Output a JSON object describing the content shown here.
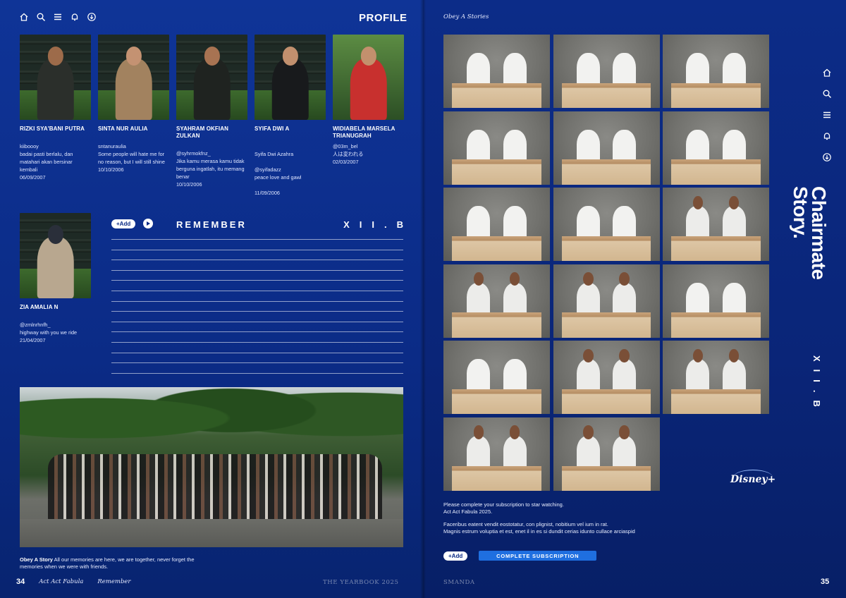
{
  "left": {
    "header": {
      "title": "PROFILE"
    },
    "icons": [
      "home-icon",
      "search-icon",
      "menu-icon",
      "bell-icon",
      "download-icon"
    ],
    "profiles": [
      {
        "name": "RIZKI SYA'BANI PUTRA",
        "handle": "kiiboooy",
        "quote": "badai pasti berlalu, dan matahari akan bersinar kembali",
        "date": "06/09/2007"
      },
      {
        "name": "SINTA NUR AULIA",
        "handle": "sntanuraulia",
        "quote": "Some people will hate me for no reason, but I will still shine",
        "date": "10/10/2006"
      },
      {
        "name": "SYAHRAM OKFIAN ZULKAN",
        "handle": "@syhrmokfnz_",
        "quote": "Jika kamu merasa kamu tidak berguna ingatlah, itu memang benar",
        "date": "10/10/2006"
      },
      {
        "name": "SYIFA DWI A",
        "handle": "Syifa Dwi Azahra",
        "quote": "@syifadazz\npeace love and gawl",
        "date": "11/09/2006"
      },
      {
        "name": "WIDIABELA MARSELA TRIANUGRAH",
        "handle": "@03m_bel",
        "quote": "人は変われる",
        "date": "02/03/2007"
      }
    ],
    "solo": {
      "name": "ZIA AMALIA N",
      "handle": "@zmlnrhnfh_",
      "quote": "highway with you we ride",
      "date": "21/04/2007"
    },
    "remember": {
      "add_label": "+Add",
      "title": "REMEMBER",
      "class_label": "XII.B"
    },
    "caption": {
      "bold": "Obey A Story",
      "text": " All our memories are here, we are together, never forget the memories when we were with friends."
    },
    "footer": {
      "page": "34",
      "script1": "Act Act Fabula",
      "script2": "Remember",
      "center": "THE YEARBOOK 2025"
    }
  },
  "right": {
    "brand": "Obey A Stories",
    "icons": [
      "home-icon",
      "search-icon",
      "menu-icon",
      "bell-icon",
      "download-icon"
    ],
    "vertical_title": "Chairmate\nStory.",
    "vertical_class": "XII.B",
    "logo": "Disney+",
    "sub_text_1": "Please complete your subscription to star watching.\nAct Act Fabula 2025.",
    "sub_text_2": "Faceribus eatent vendit eostotatur, con plignist, nobitium vel ium in rat.\nMagnis estrum voluptia et est, enet il in es si dundit cerias idunto cullace arciaspid",
    "add_label": "+Add",
    "cta_label": "COMPLETE SUBSCRIPTION",
    "footer": {
      "center": "SMANDA",
      "page": "35"
    }
  },
  "colors": {
    "accent": "#1f6fe0",
    "background": "#0b2b86",
    "text": "#ffffff"
  }
}
